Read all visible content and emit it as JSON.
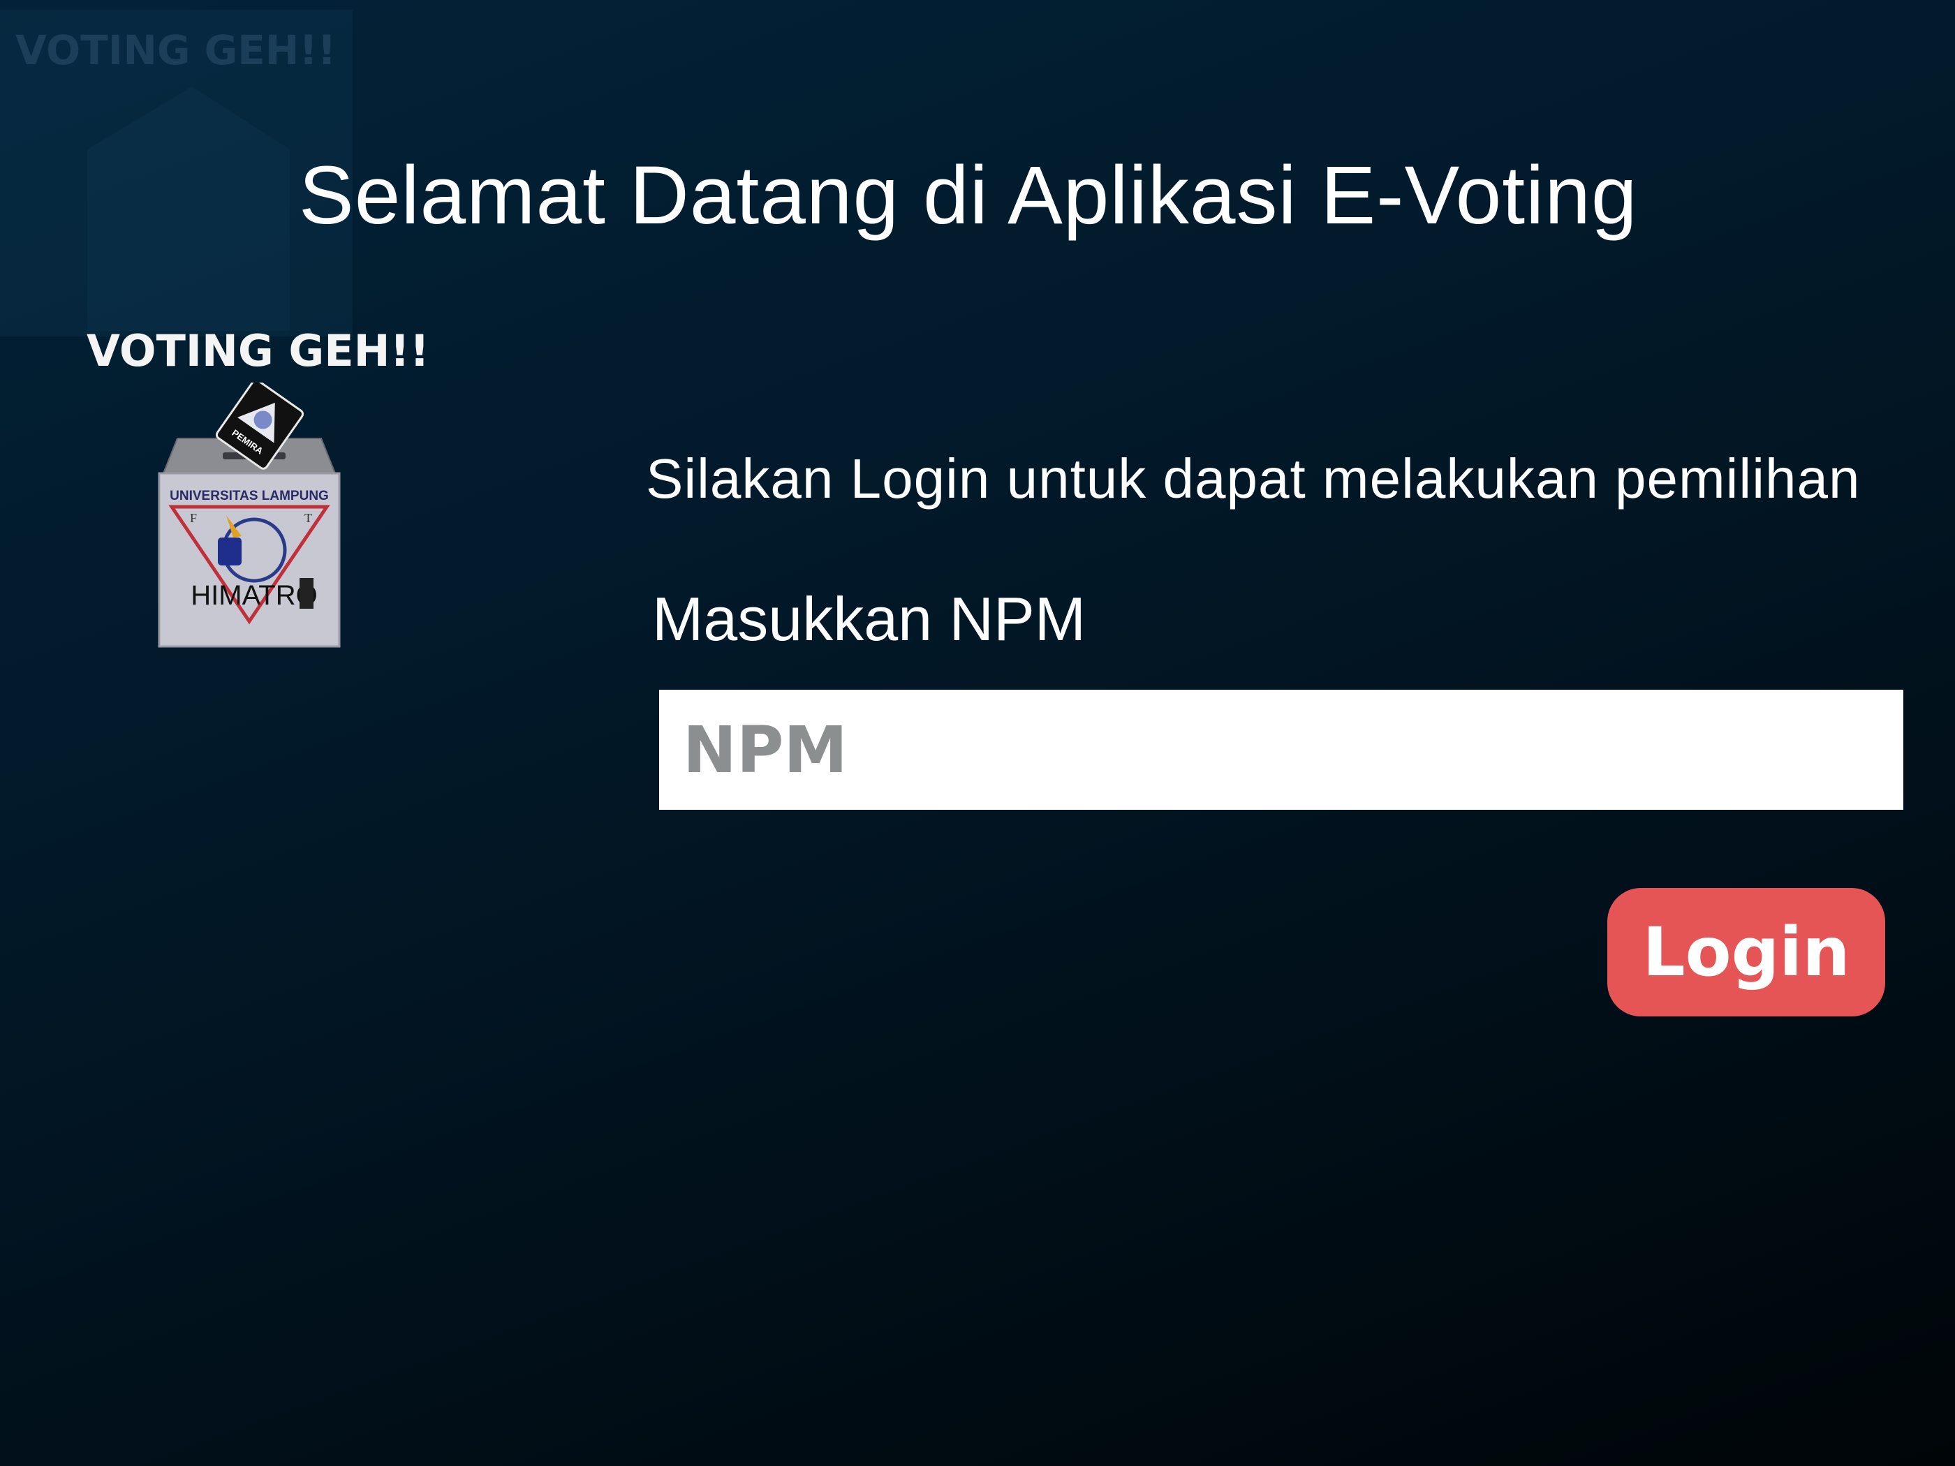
{
  "page": {
    "title": "Selamat Datang di Aplikasi E-Voting",
    "subtitle": "Silakan Login untuk dapat melakukan pemilihan"
  },
  "brand": {
    "name": "VOTING GEH!!",
    "ghost_name": "VOTING GEH!!",
    "logo": {
      "icon": "ballot-box-icon",
      "box_text": "UNIVERSITAS LAMPUNG",
      "card_text": "PEMIRA",
      "emblem_letters_left": "F",
      "emblem_letters_right": "T",
      "emblem_text": "HIMATRO"
    }
  },
  "login_form": {
    "npm_label": "Masukkan NPM",
    "npm_placeholder": "NPM",
    "npm_value": "",
    "login_button_label": "Login"
  },
  "colors": {
    "background_top": "#032238",
    "background_bottom": "#000508",
    "button": "#e65555",
    "text": "#ffffff",
    "placeholder": "#8c8f8f"
  }
}
